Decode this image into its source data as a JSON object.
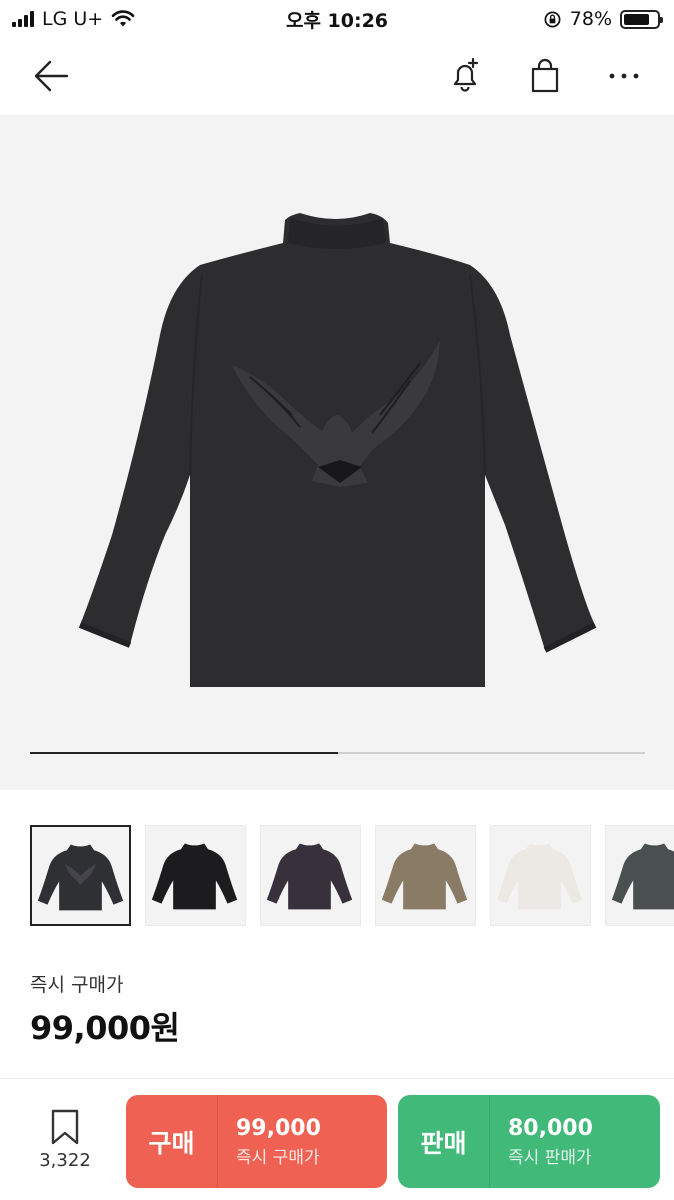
{
  "status_bar": {
    "carrier": "LG U+",
    "time": "오후 10:26",
    "battery": "78%",
    "battery_level": 0.78
  },
  "nav": {
    "back_icon": "arrow-left-icon",
    "alert_icon": "bell-plus-icon",
    "bag_icon": "shopping-bag-icon",
    "more_icon": "more-dots-icon"
  },
  "product": {
    "image": "black long-sleeve mock-neck shirt with dove graphic on back",
    "gallery_progress": 0.5,
    "thumbnails": [
      {
        "color": "#2f3034",
        "selected": true,
        "graphic": "dove"
      },
      {
        "color": "#1c1c1e",
        "selected": false
      },
      {
        "color": "#38303a",
        "selected": false
      },
      {
        "color": "#8a7b66",
        "selected": false
      },
      {
        "color": "#ece9e4",
        "selected": false
      },
      {
        "color": "#4a504f",
        "selected": false
      }
    ]
  },
  "price": {
    "label": "즉시 구매가",
    "value": "99,000원"
  },
  "bottom_bar": {
    "bookmark_count": "3,322",
    "buy": {
      "label": "구매",
      "price": "99,000",
      "sub": "즉시 구매가",
      "color": "#ef6253"
    },
    "sell": {
      "label": "판매",
      "price": "80,000",
      "sub": "즉시 판매가",
      "color": "#41b979"
    }
  }
}
